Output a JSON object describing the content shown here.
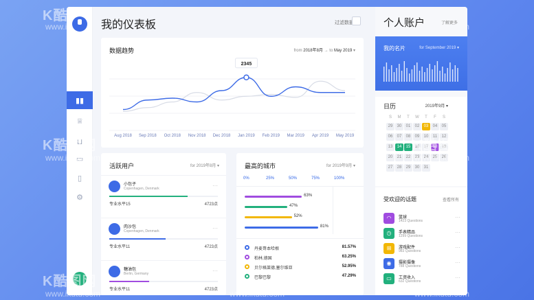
{
  "header": {
    "title": "我的仪表板",
    "filter_label": "过滤数据"
  },
  "trend": {
    "title": "数据趋势",
    "from_label": "from",
    "from_value": "2018年8月",
    "to_label": "to",
    "to_value": "May 2019",
    "tooltip": "2345"
  },
  "chart_data": {
    "type": "line",
    "x": [
      "Aug 2018",
      "Sep 2018",
      "Oct 2018",
      "Nov 2018",
      "Dec 2018",
      "Jan 2019",
      "Feb 2019",
      "Mar 2019",
      "Apr 2019",
      "May 2019"
    ],
    "series": [
      {
        "color": "#3d6be6",
        "values": [
          0.1,
          0.35,
          0.4,
          0.3,
          0.6,
          0.95,
          0.45,
          0.7,
          0.55,
          0.55
        ]
      },
      {
        "color": "#d8dce6",
        "values": [
          0.05,
          0.15,
          0.3,
          0.55,
          0.35,
          0.45,
          0.5,
          0.42,
          0.85,
          0.6
        ]
      }
    ],
    "highlight": {
      "x": "Jan 2019",
      "label": "2345"
    }
  },
  "active_users": {
    "title": "活跃用户",
    "selector": "for 2019年8月",
    "rows": [
      {
        "name": "小包子",
        "location": "Copenhagen, Denmark",
        "level": "专业水平15",
        "points": "4723点",
        "progress": 0.72,
        "color": "#22b07d"
      },
      {
        "name": "肉沙包",
        "location": "Copenhagen, Denmark",
        "level": "专业水平11",
        "points": "4723点",
        "progress": 0.52,
        "color": "#3d6be6"
      },
      {
        "name": "糖油包",
        "location": "Berlin, Germany",
        "level": "专业水平11",
        "points": "4723点",
        "progress": 0.37,
        "color": "#a04ce0"
      }
    ]
  },
  "cities": {
    "title": "最高的城市",
    "selector": "for 2019年9月",
    "axis": [
      "0%",
      "25%",
      "50%",
      "75%",
      "100%"
    ],
    "bars": [
      {
        "label": "63%",
        "value": 0.63,
        "color": "#a04ce0"
      },
      {
        "label": "47%",
        "value": 0.47,
        "color": "#22b07d"
      },
      {
        "label": "52%",
        "value": 0.52,
        "color": "#f2b705"
      },
      {
        "label": "81%",
        "value": 0.81,
        "color": "#3d6be6"
      }
    ],
    "legend": [
      {
        "name": "丹麦哥本哈根",
        "value": "81.57%",
        "color": "#3d6be6"
      },
      {
        "name": "柏林,德国",
        "value": "63.25%",
        "color": "#a04ce0"
      },
      {
        "name": "贝尔格莱德,塞尔维亚",
        "value": "52.95%",
        "color": "#f2b705"
      },
      {
        "name": "巴黎巴黎",
        "value": "47.29%",
        "color": "#22b07d"
      }
    ]
  },
  "account": {
    "title": "个人账户",
    "more": "了解更多",
    "namecard_title": "我的名片",
    "namecard_filter": "for September 2019",
    "calendar_title": "日历",
    "calendar_month": "2019年9月",
    "weekdays": [
      "S",
      "M",
      "T",
      "W",
      "T",
      "F",
      "S"
    ],
    "days": [
      "29",
      "30",
      "01",
      "02",
      "03",
      "04",
      "05",
      "06",
      "07",
      "08",
      "09",
      "10",
      "11",
      "12",
      "13",
      "14",
      "15",
      "16",
      "17",
      "18",
      "19",
      "20",
      "21",
      "22",
      "23",
      "24",
      "25",
      "26",
      "27",
      "28",
      "29",
      "30",
      "31"
    ]
  },
  "topics": {
    "title": "受欢迎的话题",
    "filter": "查看所有",
    "items": [
      {
        "name": "篮球",
        "count": "1423 Questions",
        "color": "#a04ce0",
        "icon": "headphones-icon"
      },
      {
        "name": "手表精品",
        "count": "1299 Questions",
        "color": "#22b07d",
        "icon": "watch-icon"
      },
      {
        "name": "游戏配件",
        "count": "983 Questions",
        "color": "#f2b705",
        "icon": "gamepad-icon"
      },
      {
        "name": "摄影摄像",
        "count": "788 Questions",
        "color": "#3d6be6",
        "icon": "camera-icon"
      },
      {
        "name": "工资收入",
        "count": "632 Questions",
        "color": "#22b07d",
        "icon": "money-icon"
      }
    ]
  },
  "watermark": {
    "brand": "K酷图网",
    "url": "www.ikutu.com"
  }
}
